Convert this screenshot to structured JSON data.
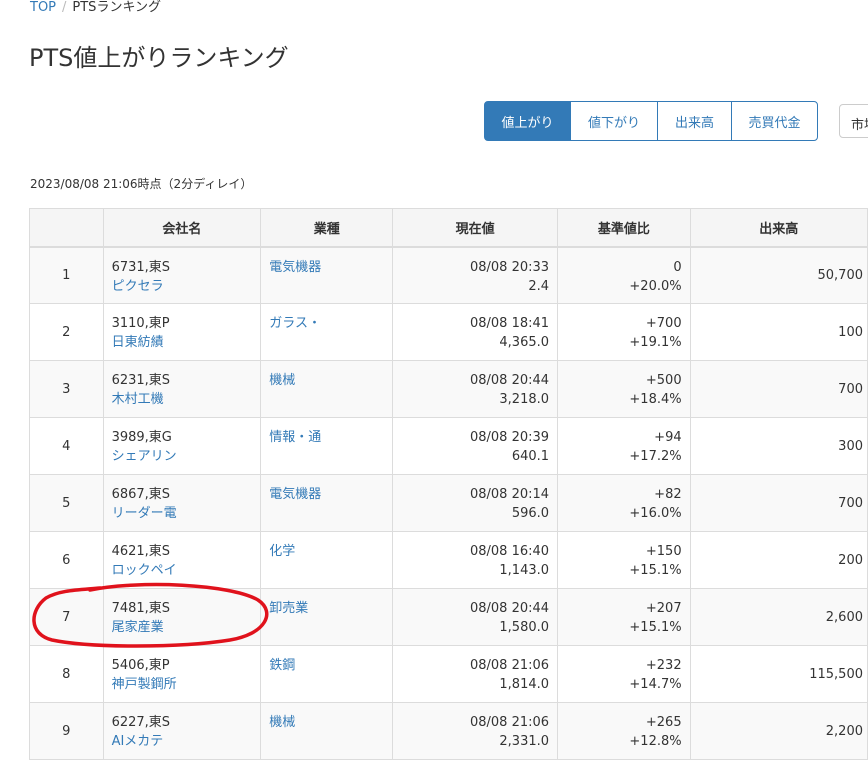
{
  "breadcrumb": {
    "top": "TOP",
    "current": "PTSランキング"
  },
  "title": "PTS値上がりランキング",
  "tabs": [
    "値上がり",
    "値下がり",
    "出来高",
    "売買代金"
  ],
  "extra_button": "市場",
  "timestamp": "2023/08/08 21:06時点（2分ディレイ）",
  "table": {
    "headers": [
      "",
      "会社名",
      "業種",
      "現在値",
      "基準値比",
      "出来高"
    ],
    "rows": [
      {
        "rank": "1",
        "code": "6731,東S",
        "name": "ピクセラ",
        "industry": "電気機器",
        "time": "08/08 20:33",
        "price": "2.4",
        "change": "0",
        "pct": "+20.0%",
        "volume": "50,700"
      },
      {
        "rank": "2",
        "code": "3110,東P",
        "name": "日東紡績",
        "industry": "ガラス・",
        "time": "08/08 18:41",
        "price": "4,365.0",
        "change": "+700",
        "pct": "+19.1%",
        "volume": "100"
      },
      {
        "rank": "3",
        "code": "6231,東S",
        "name": "木村工機",
        "industry": "機械",
        "time": "08/08 20:44",
        "price": "3,218.0",
        "change": "+500",
        "pct": "+18.4%",
        "volume": "700"
      },
      {
        "rank": "4",
        "code": "3989,東G",
        "name": "シェアリン",
        "industry": "情報・通",
        "time": "08/08 20:39",
        "price": "640.1",
        "change": "+94",
        "pct": "+17.2%",
        "volume": "300"
      },
      {
        "rank": "5",
        "code": "6867,東S",
        "name": "リーダー電",
        "industry": "電気機器",
        "time": "08/08 20:14",
        "price": "596.0",
        "change": "+82",
        "pct": "+16.0%",
        "volume": "700"
      },
      {
        "rank": "6",
        "code": "4621,東S",
        "name": "ロックペイ",
        "industry": "化学",
        "time": "08/08 16:40",
        "price": "1,143.0",
        "change": "+150",
        "pct": "+15.1%",
        "volume": "200"
      },
      {
        "rank": "7",
        "code": "7481,東S",
        "name": "尾家産業",
        "industry": "卸売業",
        "time": "08/08 20:44",
        "price": "1,580.0",
        "change": "+207",
        "pct": "+15.1%",
        "volume": "2,600"
      },
      {
        "rank": "8",
        "code": "5406,東P",
        "name": "神戸製鋼所",
        "industry": "鉄鋼",
        "time": "08/08 21:06",
        "price": "1,814.0",
        "change": "+232",
        "pct": "+14.7%",
        "volume": "115,500"
      },
      {
        "rank": "9",
        "code": "6227,東S",
        "name": "AIメカテ",
        "industry": "機械",
        "time": "08/08 21:06",
        "price": "2,331.0",
        "change": "+265",
        "pct": "+12.8%",
        "volume": "2,200"
      }
    ]
  },
  "colors": {
    "accent": "#337ab7",
    "annotation": "#e0121c"
  }
}
